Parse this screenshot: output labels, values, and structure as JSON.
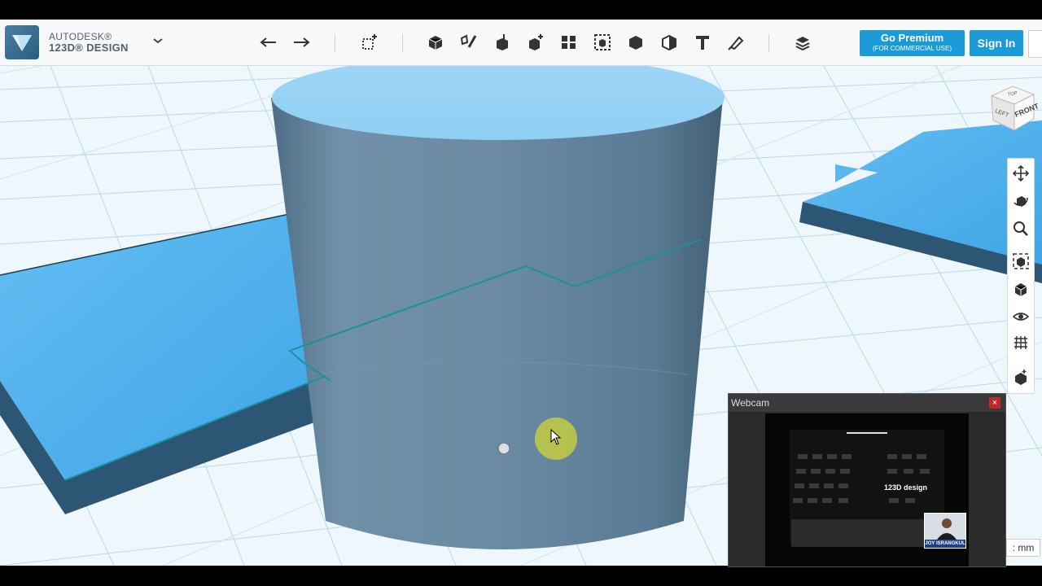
{
  "app": {
    "brand_line1": "AUTODESK®",
    "brand_line2": "123D® DESIGN"
  },
  "toolbar": {
    "icons": [
      "undo-icon",
      "redo-icon",
      "transform-icon",
      "primitives-icon",
      "sketch-icon",
      "construct-icon",
      "modify-icon",
      "pattern-icon",
      "grouping-icon",
      "combine-icon",
      "measure-icon",
      "text-icon",
      "snap-icon",
      "material-icon"
    ],
    "premium_label": "Go Premium",
    "premium_sublabel": "(FOR COMMERCIAL USE)",
    "signin_label": "Sign In"
  },
  "viewcube": {
    "top": "TOP",
    "left": "LEFT",
    "front": "FRONT"
  },
  "navigation": [
    "pan-icon",
    "orbit-icon",
    "zoom-icon",
    "fit-icon",
    "view-mode-icon",
    "visibility-icon",
    "grid-icon",
    "material-visibility-icon"
  ],
  "units_label": ": mm",
  "webcam": {
    "title": "Webcam",
    "close": "×",
    "video_title": "123D design",
    "pip_label": "JOY ISRANGKUL"
  },
  "colors": {
    "accent": "#1a9ad6",
    "grid_bg": "#eef7fb",
    "plate": "#5ab4ee",
    "cylinder": "#6d8ea6"
  }
}
